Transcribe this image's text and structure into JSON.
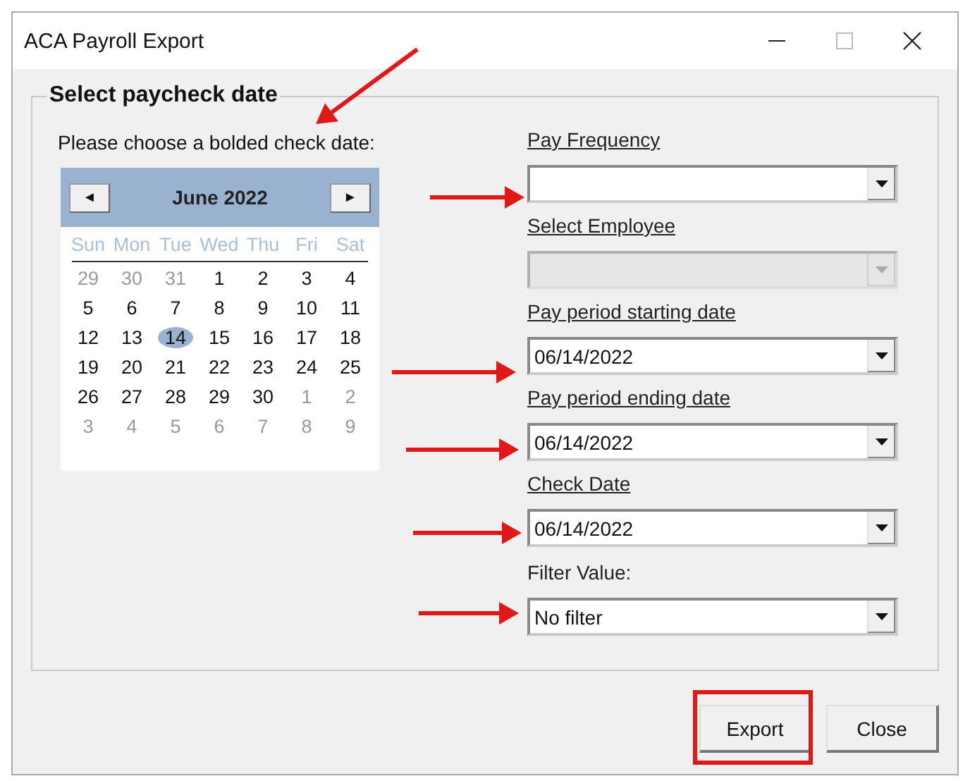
{
  "window": {
    "title": "ACA Payroll Export"
  },
  "group": {
    "title": "Select paycheck date",
    "prompt": "Please choose a bolded check date:"
  },
  "calendar": {
    "month": "June 2022",
    "prev": "◄",
    "next": "►",
    "weekdays": [
      "Sun",
      "Mon",
      "Tue",
      "Wed",
      "Thu",
      "Fri",
      "Sat"
    ],
    "weeks": [
      [
        {
          "day": "29",
          "muted": true,
          "selected": false
        },
        {
          "day": "30",
          "muted": true,
          "selected": false
        },
        {
          "day": "31",
          "muted": true,
          "selected": false
        },
        {
          "day": "1",
          "muted": false,
          "selected": false
        },
        {
          "day": "2",
          "muted": false,
          "selected": false
        },
        {
          "day": "3",
          "muted": false,
          "selected": false
        },
        {
          "day": "4",
          "muted": false,
          "selected": false
        }
      ],
      [
        {
          "day": "5",
          "muted": false,
          "selected": false
        },
        {
          "day": "6",
          "muted": false,
          "selected": false
        },
        {
          "day": "7",
          "muted": false,
          "selected": false
        },
        {
          "day": "8",
          "muted": false,
          "selected": false
        },
        {
          "day": "9",
          "muted": false,
          "selected": false
        },
        {
          "day": "10",
          "muted": false,
          "selected": false
        },
        {
          "day": "11",
          "muted": false,
          "selected": false
        }
      ],
      [
        {
          "day": "12",
          "muted": false,
          "selected": false
        },
        {
          "day": "13",
          "muted": false,
          "selected": false
        },
        {
          "day": "14",
          "muted": false,
          "selected": true
        },
        {
          "day": "15",
          "muted": false,
          "selected": false
        },
        {
          "day": "16",
          "muted": false,
          "selected": false
        },
        {
          "day": "17",
          "muted": false,
          "selected": false
        },
        {
          "day": "18",
          "muted": false,
          "selected": false
        }
      ],
      [
        {
          "day": "19",
          "muted": false,
          "selected": false
        },
        {
          "day": "20",
          "muted": false,
          "selected": false
        },
        {
          "day": "21",
          "muted": false,
          "selected": false
        },
        {
          "day": "22",
          "muted": false,
          "selected": false
        },
        {
          "day": "23",
          "muted": false,
          "selected": false
        },
        {
          "day": "24",
          "muted": false,
          "selected": false
        },
        {
          "day": "25",
          "muted": false,
          "selected": false
        }
      ],
      [
        {
          "day": "26",
          "muted": false,
          "selected": false
        },
        {
          "day": "27",
          "muted": false,
          "selected": false
        },
        {
          "day": "28",
          "muted": false,
          "selected": false
        },
        {
          "day": "29",
          "muted": false,
          "selected": false
        },
        {
          "day": "30",
          "muted": false,
          "selected": false
        },
        {
          "day": "1",
          "muted": true,
          "selected": false
        },
        {
          "day": "2",
          "muted": true,
          "selected": false
        }
      ],
      [
        {
          "day": "3",
          "muted": true,
          "selected": false
        },
        {
          "day": "4",
          "muted": true,
          "selected": false
        },
        {
          "day": "5",
          "muted": true,
          "selected": false
        },
        {
          "day": "6",
          "muted": true,
          "selected": false
        },
        {
          "day": "7",
          "muted": true,
          "selected": false
        },
        {
          "day": "8",
          "muted": true,
          "selected": false
        },
        {
          "day": "9",
          "muted": true,
          "selected": false
        }
      ]
    ]
  },
  "fields": [
    {
      "label": "Pay Frequency",
      "underlined": true,
      "disabled": false
    },
    {
      "label": "Select Employee",
      "underlined": true,
      "disabled": true
    },
    {
      "label": "Pay period starting date",
      "underlined": true,
      "disabled": false,
      "value": "06/14/2022"
    },
    {
      "label": "Pay period ending date",
      "underlined": true,
      "disabled": false,
      "value": "06/14/2022"
    },
    {
      "label": "Check Date",
      "underlined": true,
      "disabled": false,
      "value": "06/14/2022"
    },
    {
      "label": "Filter Value:",
      "underlined": false,
      "disabled": false,
      "value": "No filter"
    }
  ],
  "buttons": [
    {
      "label": "Export",
      "highlighted": true
    },
    {
      "label": "Close",
      "highlighted": false
    }
  ]
}
